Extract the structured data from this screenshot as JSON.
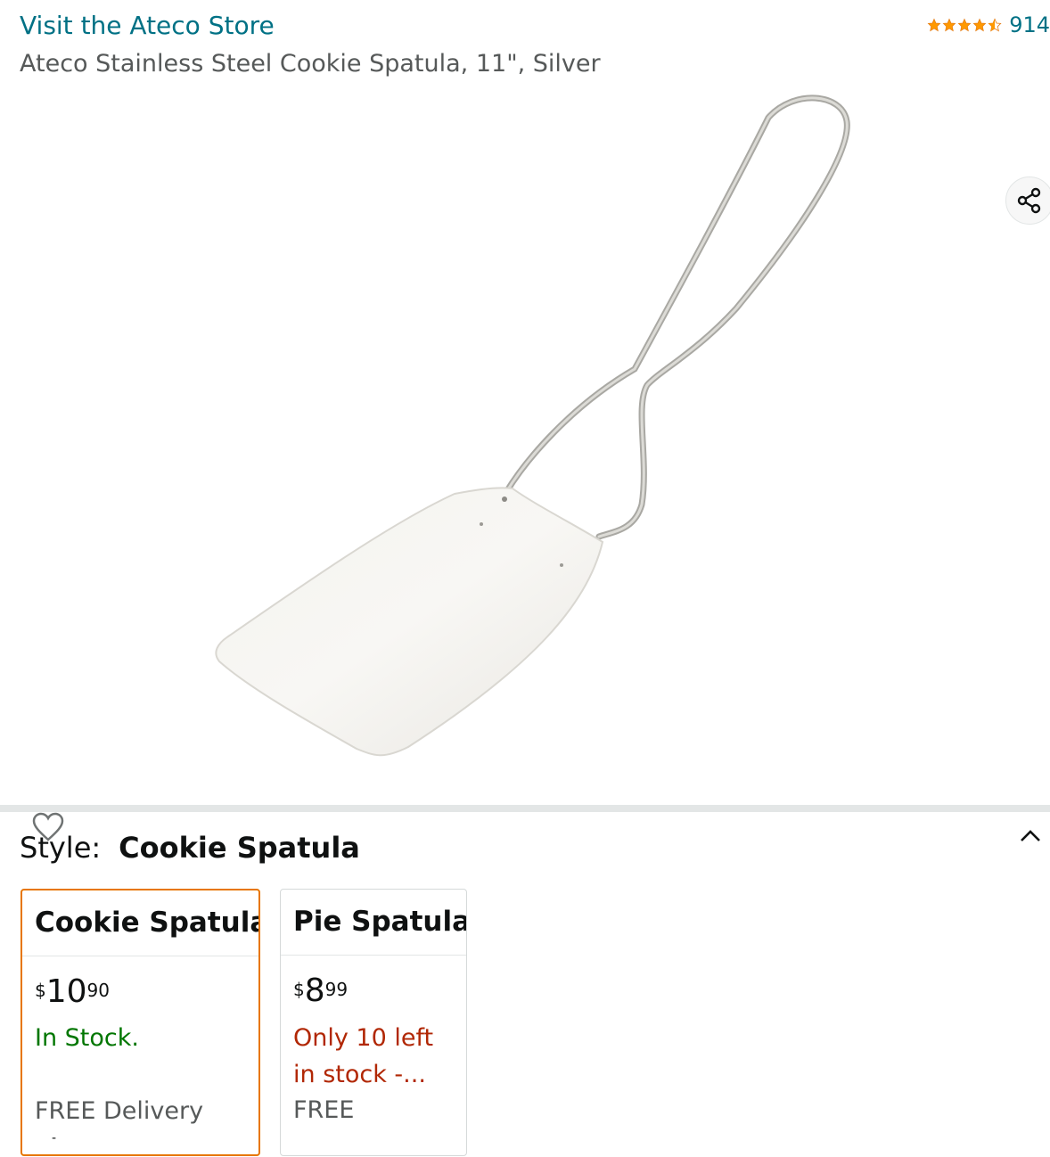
{
  "header": {
    "store_link": "Visit the Ateco Store",
    "rating_count": "914",
    "rating_value": 4.5,
    "product_title": "Ateco Stainless Steel Cookie Spatula, 11\", Silver"
  },
  "image": {
    "alt": "Ateco Stainless Steel Cookie Spatula"
  },
  "icons": {
    "share": "share-icon",
    "wishlist": "heart-icon",
    "collapse": "chevron-up-icon",
    "star": "star-icon"
  },
  "style_selector": {
    "label": "Style:",
    "selected_value": "Cookie Spatula",
    "options": [
      {
        "name": "Cookie Spatula",
        "price_symbol": "$",
        "price_whole": "10",
        "price_fraction": "90",
        "stock_text": "In Stock.",
        "delivery": "FREE Delivery",
        "extra": "-"
      },
      {
        "name": "Pie Spatula",
        "price_symbol": "$",
        "price_whole": "8",
        "price_fraction": "99",
        "stock_text": "Only 10 left in stock -...",
        "delivery": "FREE"
      }
    ]
  },
  "colors": {
    "link": "#007185",
    "star": "#ff9900",
    "in_stock": "#007600",
    "low_stock": "#b12704",
    "selected_border": "#e77600"
  }
}
